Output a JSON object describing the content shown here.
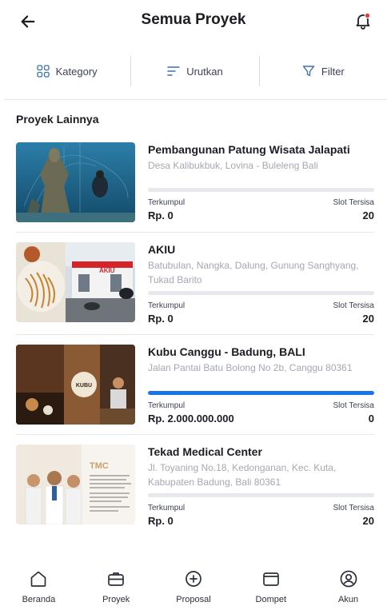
{
  "header": {
    "title": "Semua Proyek"
  },
  "filters": [
    {
      "label": "Kategory",
      "icon": "grid-icon"
    },
    {
      "label": "Urutkan",
      "icon": "sort-icon"
    },
    {
      "label": "Filter",
      "icon": "filter-icon"
    }
  ],
  "section_title": "Proyek Lainnya",
  "labels": {
    "collected": "Terkumpul",
    "slots": "Slot Tersisa"
  },
  "projects": [
    {
      "name": "Pembangunan Patung Wisata Jalapati",
      "address": "Desa Kalibukbuk, Lovina - Buleleng Bali",
      "collected": "Rp. 0",
      "slots": "20",
      "progress": 0
    },
    {
      "name": "AKIU",
      "address": "Batubulan, Nangka, Dalung, Gunung Sanghyang, Tukad Barito",
      "collected": "Rp. 0",
      "slots": "20",
      "progress": 0,
      "image_text": "AKIU"
    },
    {
      "name": "Kubu Canggu - Badung, BALI",
      "address": "Jalan Pantai Batu Bolong No 2b, Canggu 80361",
      "collected": "Rp. 2.000.000.000",
      "slots": "0",
      "progress": 1.0,
      "image_text": "KUBU"
    },
    {
      "name": "Tekad Medical Center",
      "address": "Jl. Toyaning No.18, Kedonganan, Kec. Kuta, Kabupaten Badung, Bali 80361",
      "collected": "Rp. 0",
      "slots": "20",
      "progress": 0,
      "image_text": "TMC"
    }
  ],
  "nav": [
    {
      "label": "Beranda",
      "icon": "home-icon"
    },
    {
      "label": "Proyek",
      "icon": "briefcase-icon"
    },
    {
      "label": "Proposal",
      "icon": "plus-circle-icon"
    },
    {
      "label": "Dompet",
      "icon": "wallet-icon"
    },
    {
      "label": "Akun",
      "icon": "user-icon"
    }
  ],
  "colors": {
    "accent": "#1a73e8",
    "notification": "#e53935",
    "muted_text": "#a4a8b2"
  }
}
